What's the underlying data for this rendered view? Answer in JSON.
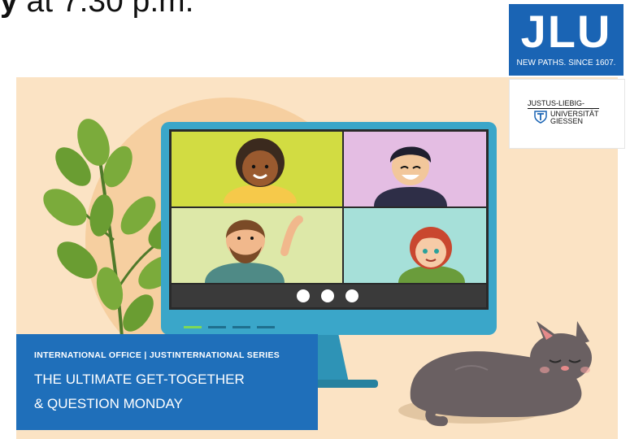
{
  "heading": {
    "bold": "y",
    "rest": " at 7:30 p.m."
  },
  "logo": {
    "letters": "JLU",
    "tagline": "NEW PATHS. SINCE 1607."
  },
  "university": {
    "line1": "JUSTUS-LIEBIG-",
    "line2": "UNIVERSITÄT",
    "line3": "GIESSEN"
  },
  "event": {
    "series": "INTERNATIONAL OFFICE | JUSTINTERNATIONAL SERIES",
    "title_line1": "THE ULTIMATE GET-TOGETHER",
    "title_line2": "& QUESTION MONDAY"
  },
  "colors": {
    "brand_blue": "#1a64b4",
    "title_box_blue": "#1f6fba",
    "banner_bg": "#fbe3c4",
    "monitor_frame": "#3aa6c9"
  },
  "illustration": {
    "icons": [
      "potted-plant",
      "computer-monitor",
      "video-call-participants",
      "sleeping-cat"
    ]
  }
}
